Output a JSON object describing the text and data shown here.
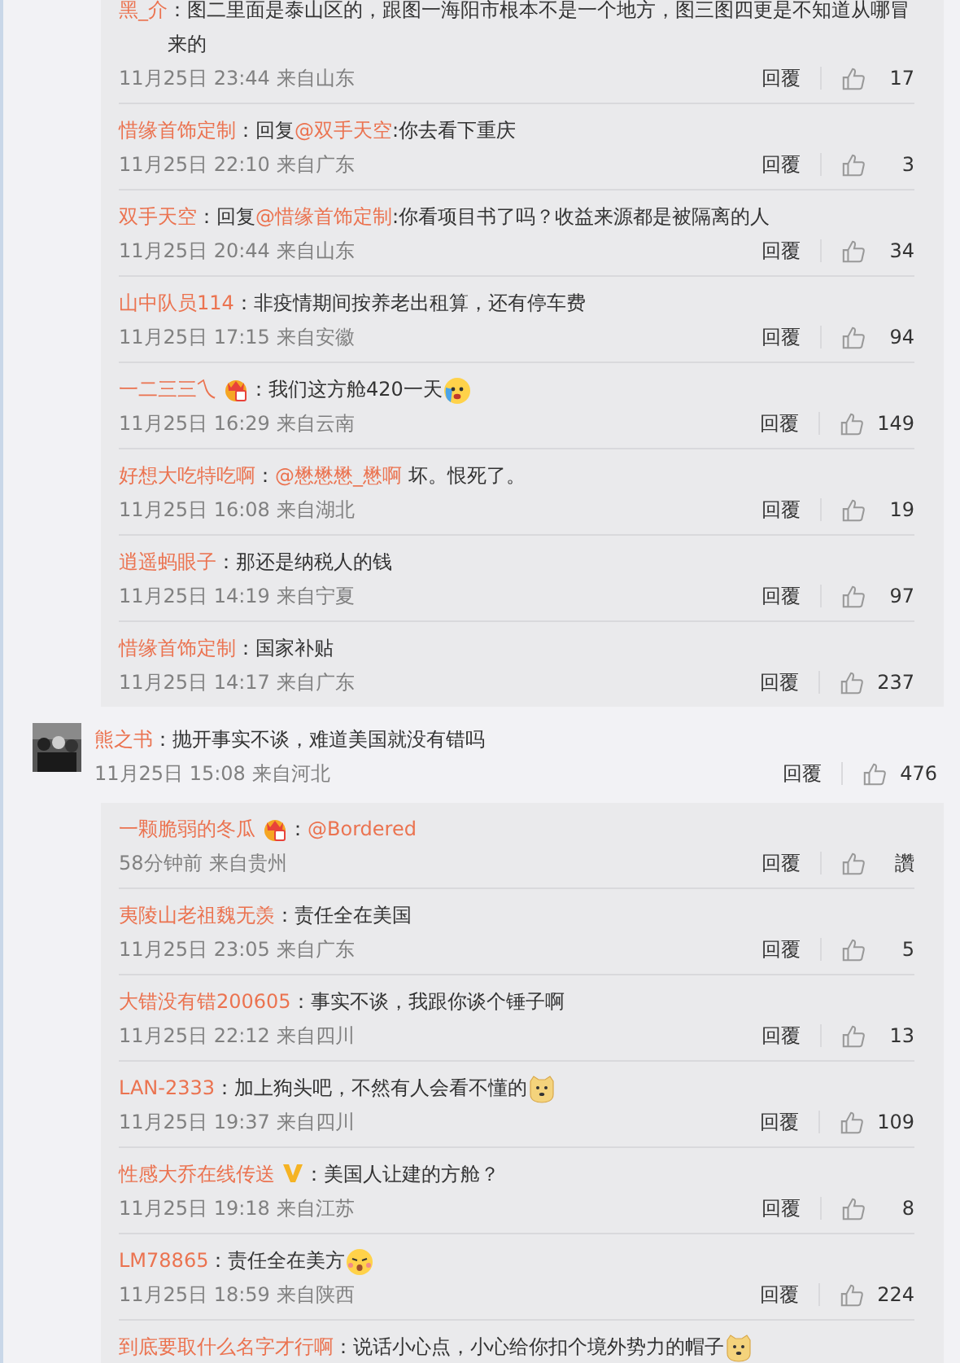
{
  "sections": [
    {
      "kind": "replies",
      "replies": [
        {
          "author": "黑_介",
          "parts": [
            {
              "kind": "plain",
              "text": "：图二里面是泰山区的，跟图一海阳市根本不是一个地方，图三图四更是不知道从哪冒来的"
            }
          ],
          "time": "11月25日 23:44",
          "source": "来自山东",
          "reply": "回覆",
          "likes": "17"
        },
        {
          "author": "惜缘首饰定制",
          "parts": [
            {
              "kind": "plain",
              "text": "：回复"
            },
            {
              "kind": "mention",
              "text": "@双手天空"
            },
            {
              "kind": "plain",
              "text": ":你去看下重庆"
            }
          ],
          "time": "11月25日 22:10",
          "source": "来自广东",
          "reply": "回覆",
          "likes": "3"
        },
        {
          "author": "双手天空",
          "parts": [
            {
              "kind": "plain",
              "text": "：回复"
            },
            {
              "kind": "mention",
              "text": "@惜缘首饰定制"
            },
            {
              "kind": "plain",
              "text": ":你看项目书了吗？收益来源都是被隔离的人"
            }
          ],
          "time": "11月25日 20:44",
          "source": "来自山东",
          "reply": "回覆",
          "likes": "34"
        },
        {
          "author": "山中队员114",
          "parts": [
            {
              "kind": "plain",
              "text": "：非疫情期间按养老出租算，还有停车费"
            }
          ],
          "time": "11月25日 17:15",
          "source": "来自安徽",
          "reply": "回覆",
          "likes": "94"
        },
        {
          "author": "一二三三乀",
          "badge": {
            "kind": "crown"
          },
          "parts": [
            {
              "kind": "plain",
              "text": "：我们这方舱420一天"
            }
          ],
          "emoji": {
            "kind": "cry"
          },
          "time": "11月25日 16:29",
          "source": "来自云南",
          "reply": "回覆",
          "likes": "149"
        },
        {
          "author": "好想大吃特吃啊",
          "parts": [
            {
              "kind": "plain",
              "text": "："
            },
            {
              "kind": "mention",
              "text": "@懋懋懋_懋啊"
            },
            {
              "kind": "plain",
              "text": " 坏。恨死了。"
            }
          ],
          "time": "11月25日 16:08",
          "source": "来自湖北",
          "reply": "回覆",
          "likes": "19"
        },
        {
          "author": "逍遥蚂眼子",
          "parts": [
            {
              "kind": "plain",
              "text": "：那还是纳税人的钱"
            }
          ],
          "time": "11月25日 14:19",
          "source": "来自宁夏",
          "reply": "回覆",
          "likes": "97"
        },
        {
          "author": "惜缘首饰定制",
          "parts": [
            {
              "kind": "plain",
              "text": "：国家补贴"
            }
          ],
          "time": "11月25日 14:17",
          "source": "来自广东",
          "reply": "回覆",
          "likes": "237"
        }
      ]
    },
    {
      "kind": "comment",
      "author": "熊之书",
      "parts": [
        {
          "kind": "plain",
          "text": "：抛开事实不谈，难道美国就没有错吗"
        }
      ],
      "time": "11月25日 15:08",
      "source": "来自河北",
      "reply": "回覆",
      "likes": "476"
    },
    {
      "kind": "replies",
      "replies": [
        {
          "author": "一颗脆弱的冬瓜",
          "badge": {
            "kind": "crown"
          },
          "parts": [
            {
              "kind": "plain",
              "text": "："
            },
            {
              "kind": "mention",
              "text": "@Bordered"
            }
          ],
          "time": "58分钟前",
          "source": "来自贵州",
          "reply": "回覆",
          "likes": "讚"
        },
        {
          "author": "夷陵山老祖魏无羡",
          "parts": [
            {
              "kind": "plain",
              "text": "：责任全在美国"
            }
          ],
          "time": "11月25日 23:05",
          "source": "来自广东",
          "reply": "回覆",
          "likes": "5"
        },
        {
          "author": "大错没有错200605",
          "parts": [
            {
              "kind": "plain",
              "text": "：事实不谈，我跟你谈个锤子啊"
            }
          ],
          "time": "11月25日 22:12",
          "source": "来自四川",
          "reply": "回覆",
          "likes": "13"
        },
        {
          "author": "LAN-2333",
          "parts": [
            {
              "kind": "plain",
              "text": "：加上狗头吧，不然有人会看不懂的"
            }
          ],
          "emoji": {
            "kind": "doge"
          },
          "time": "11月25日 19:37",
          "source": "来自四川",
          "reply": "回覆",
          "likes": "109"
        },
        {
          "author": "性感大乔在线传送",
          "badge": {
            "kind": "vip"
          },
          "parts": [
            {
              "kind": "plain",
              "text": "：美国人让建的方舱？"
            }
          ],
          "time": "11月25日 19:18",
          "source": "来自江苏",
          "reply": "回覆",
          "likes": "8"
        },
        {
          "author": "LM78865",
          "parts": [
            {
              "kind": "plain",
              "text": "：责任全在美方"
            }
          ],
          "emoji": {
            "kind": "shock"
          },
          "time": "11月25日 18:59",
          "source": "来自陕西",
          "reply": "回覆",
          "likes": "224"
        },
        {
          "author": "到底要取什么名字才行啊",
          "parts": [
            {
              "kind": "plain",
              "text": "：说话小心点，小心给你扣个境外势力的帽子"
            }
          ],
          "emoji": {
            "kind": "doge"
          }
        }
      ]
    }
  ]
}
